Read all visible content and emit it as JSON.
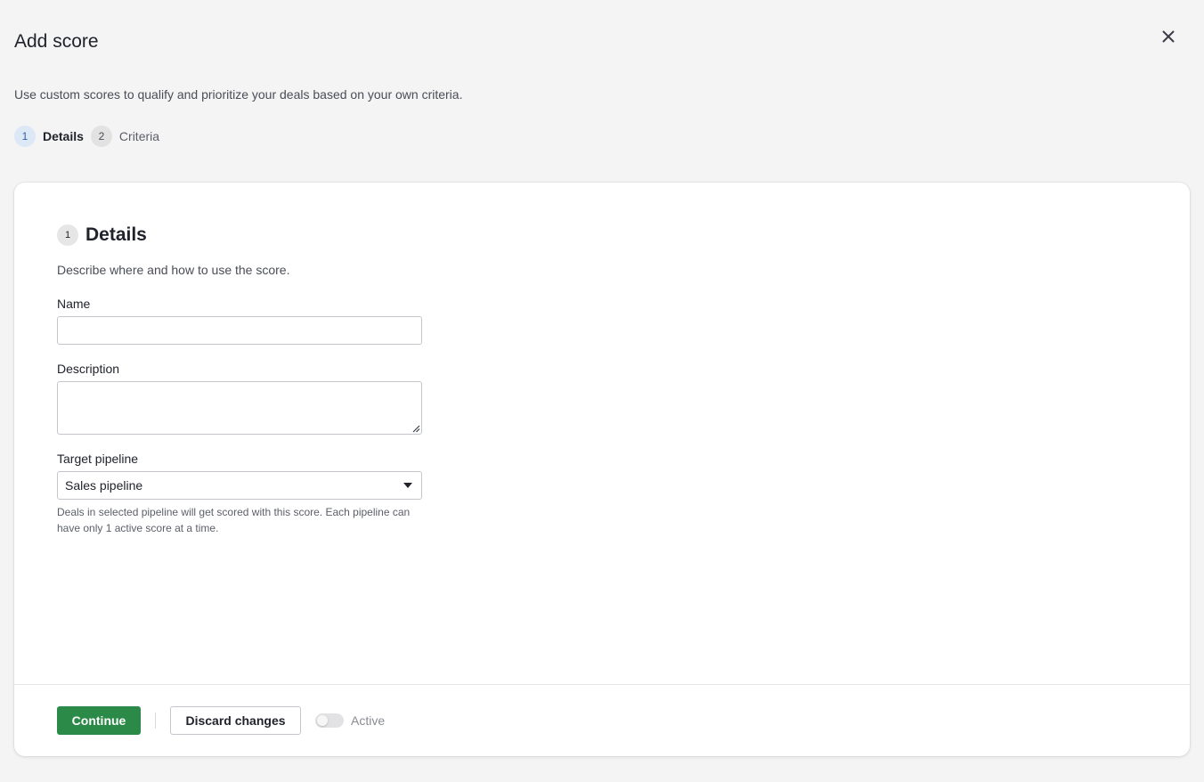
{
  "header": {
    "title": "Add score",
    "subtitle": "Use custom scores to qualify and prioritize your deals based on your own criteria."
  },
  "stepper": {
    "steps": [
      {
        "number": "1",
        "label": "Details",
        "state": "active"
      },
      {
        "number": "2",
        "label": "Criteria",
        "state": "inactive"
      }
    ]
  },
  "details": {
    "number": "1",
    "title": "Details",
    "description": "Describe where and how to use the score.",
    "name_label": "Name",
    "name_value": "",
    "description_label": "Description",
    "description_value": "",
    "pipeline_label": "Target pipeline",
    "pipeline_value": "Sales pipeline",
    "pipeline_hint": "Deals in selected pipeline will get scored with this score. Each pipeline can have only 1 active score at a time."
  },
  "footer": {
    "continue_label": "Continue",
    "discard_label": "Discard changes",
    "active_label": "Active",
    "active_on": false
  },
  "colors": {
    "background": "#f4f4f4",
    "primary": "#2c8a48",
    "step_active_bg": "#dde8f7",
    "step_inactive_bg": "#e2e2e2"
  },
  "icons": {
    "close": "close-icon",
    "dropdown": "caret-down-icon",
    "resize": "resize-grip-icon"
  }
}
